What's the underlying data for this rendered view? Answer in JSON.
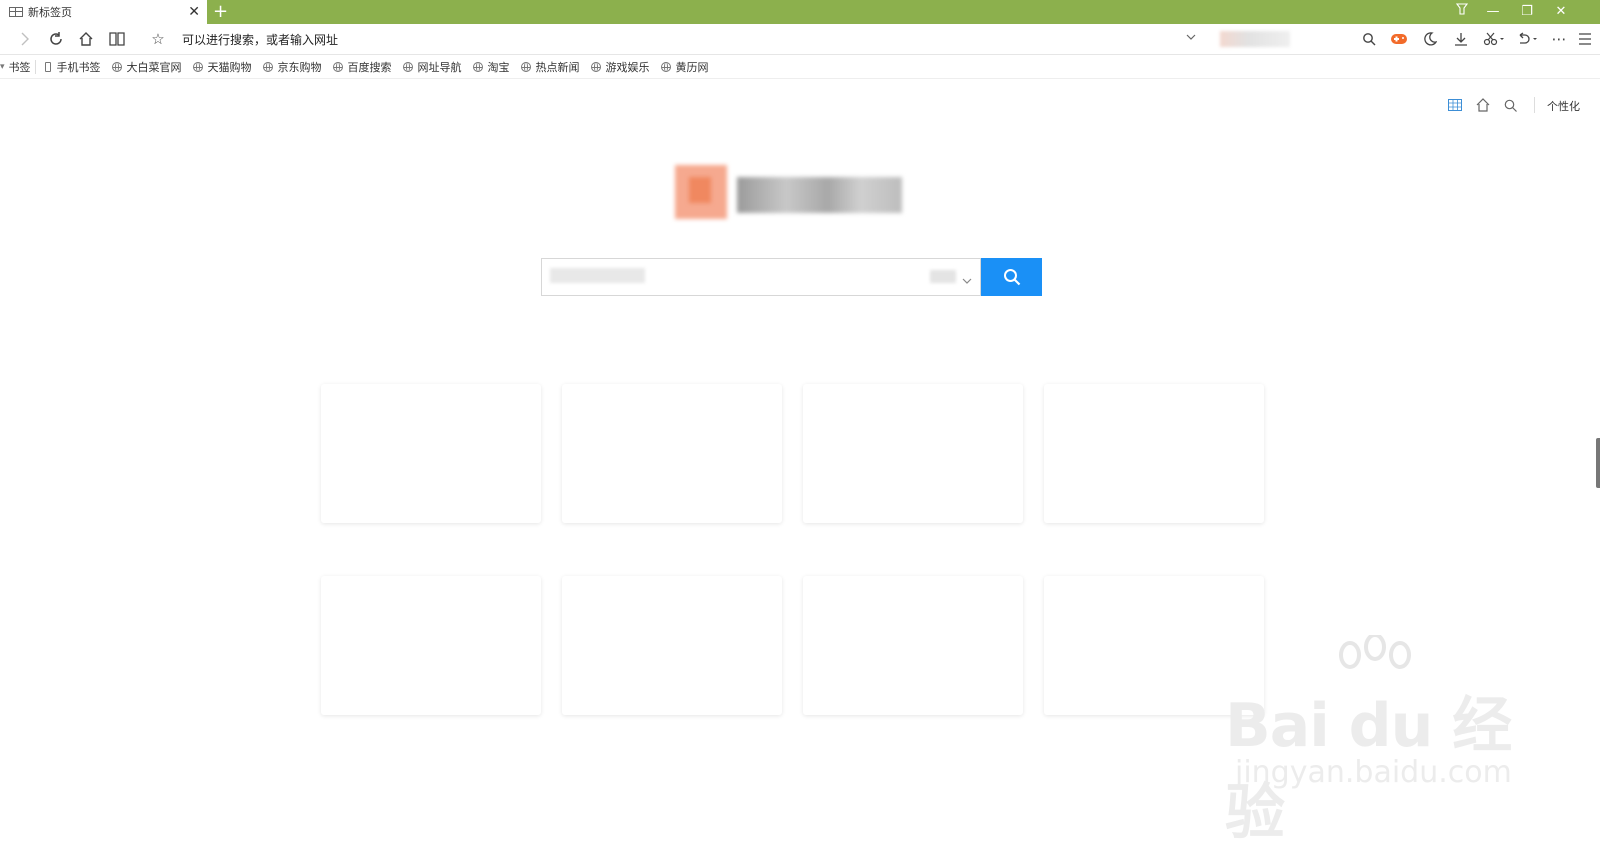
{
  "tab": {
    "title": "新标签页"
  },
  "window": {
    "controls": [
      "⊓",
      "—",
      "❐",
      "✕"
    ]
  },
  "navbar": {
    "address_placeholder": "可以进行搜索，或者输入网址"
  },
  "bookmarks": {
    "label": "书签",
    "mobile": "手机书签",
    "items": [
      "大白菜官网",
      "天猫购物",
      "京东购物",
      "百度搜索",
      "网址导航",
      "淘宝",
      "热点新闻",
      "游戏娱乐",
      "黄历网"
    ]
  },
  "toolbar_right": {
    "personalize": "个性化"
  },
  "colors": {
    "titlebar": "#8cb04d",
    "search_button": "#1a90f6"
  },
  "watermark": {
    "brand": "Bai du 经验",
    "url": "jingyan.baidu.com"
  }
}
